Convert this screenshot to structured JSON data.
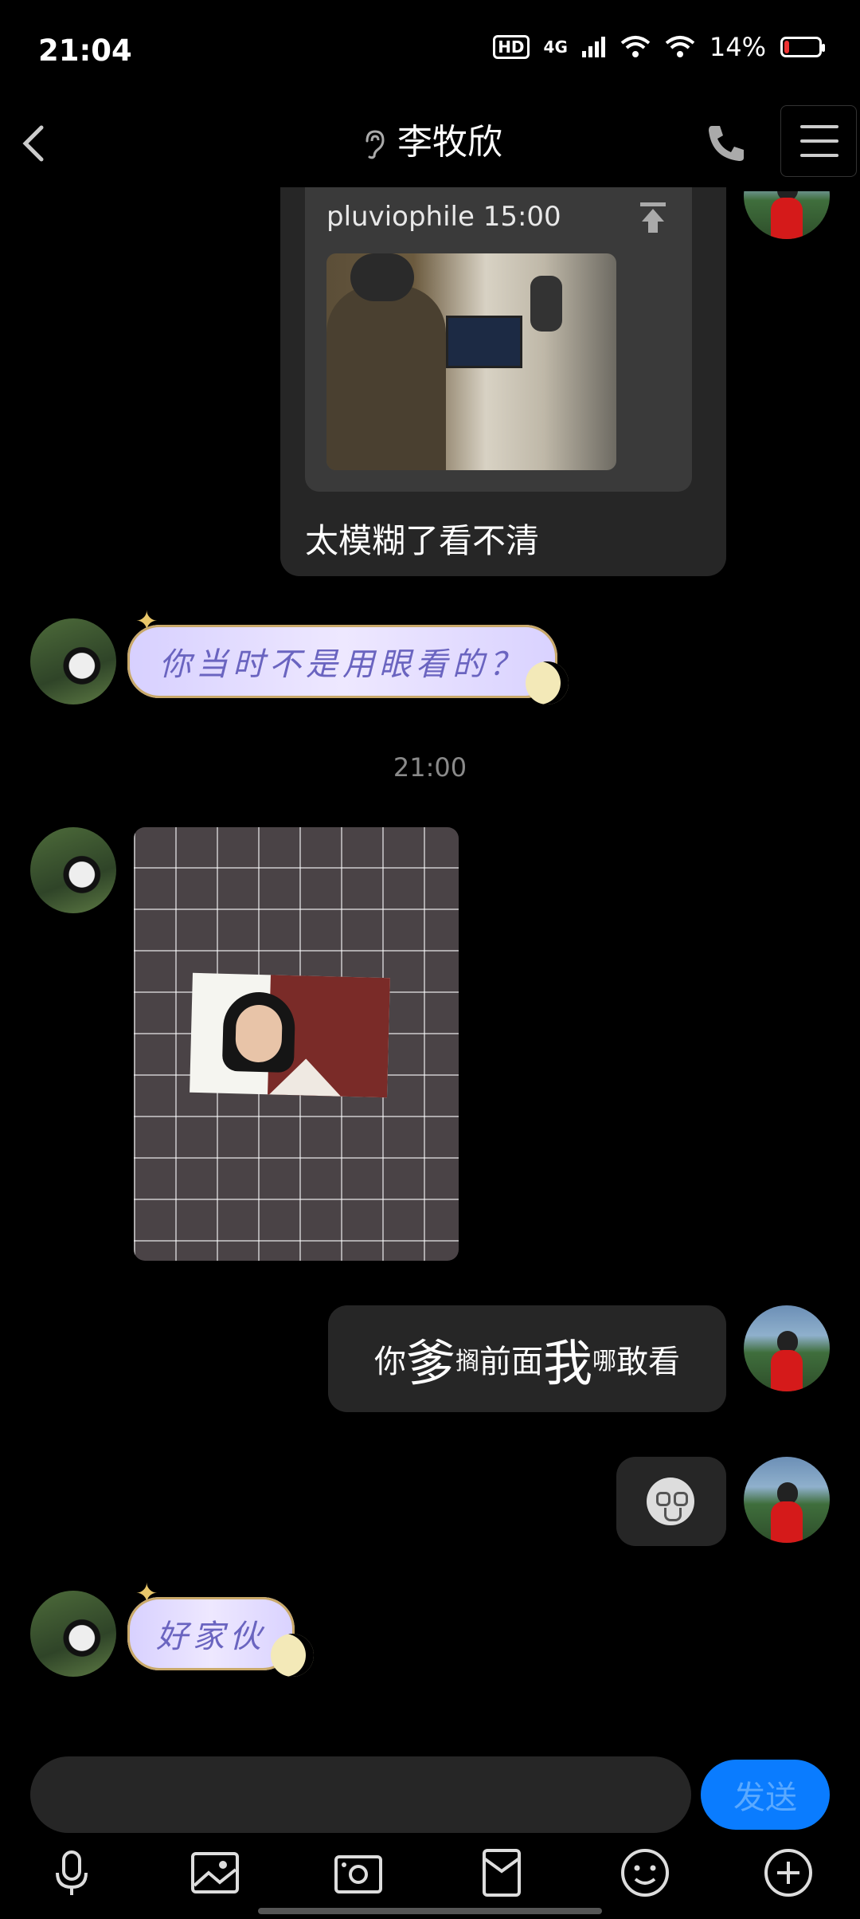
{
  "status_bar": {
    "time": "21:04",
    "hd": "HD",
    "network": "4G",
    "battery_percent": "14%",
    "battery_level": 0.14
  },
  "header": {
    "title": "李牧欣",
    "back_icon": "chevron-left-icon",
    "ear_icon": "ear-icon",
    "call_icon": "phone-icon",
    "menu_icon": "hamburger-menu-icon"
  },
  "messages": {
    "quote": {
      "meta": "pluviophile 15:00",
      "text": "太模糊了看不清"
    },
    "fancy_1": "你当时不是用眼看的？",
    "timestamp": "21:00",
    "sent_text": {
      "p1": "你",
      "p2": "爹",
      "p3": "搁",
      "p4": "前面",
      "p5": "我",
      "p6": "哪",
      "p7": "敢看"
    },
    "fancy_2": "好家伙"
  },
  "input": {
    "value": "",
    "send_label": "发送"
  },
  "toolbar": {
    "icons": [
      "microphone-icon",
      "image-icon",
      "camera-icon",
      "red-packet-icon",
      "emoji-icon",
      "plus-icon"
    ]
  },
  "colors": {
    "background": "#000000",
    "bubble": "#262626",
    "accent": "#0a7cff"
  }
}
